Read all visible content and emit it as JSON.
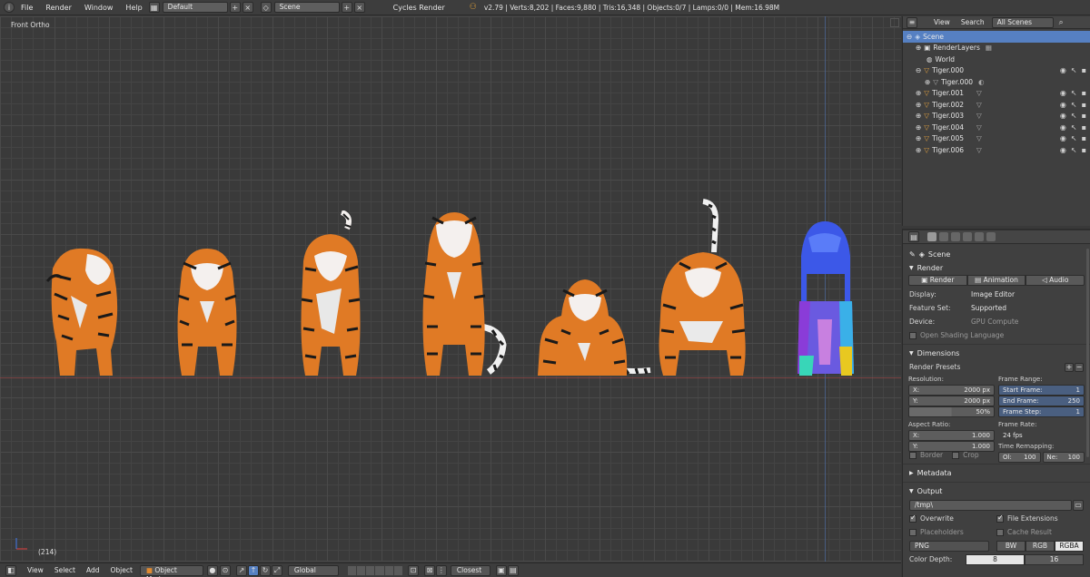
{
  "topbar": {
    "menus": [
      "File",
      "Render",
      "Window",
      "Help"
    ],
    "layout": "Default",
    "scene": "Scene",
    "engine": "Cycles Render",
    "stats": "v2.79 | Verts:8,202 | Faces:9,880 | Tris:16,348 | Objects:0/7 | Lamps:0/0 | Mem:16.98M"
  },
  "viewport": {
    "view_label": "Front Ortho",
    "frame_label": "(214)"
  },
  "bottombar": {
    "menus": [
      "View",
      "Select",
      "Add",
      "Object"
    ],
    "mode": "Object Mode",
    "pivot": "Global",
    "snap": "Closest"
  },
  "outliner": {
    "menus": [
      "View",
      "Search"
    ],
    "filter": "All Scenes",
    "items": [
      {
        "label": "Scene",
        "indent": 0
      },
      {
        "label": "RenderLayers",
        "indent": 1
      },
      {
        "label": "World",
        "indent": 1
      },
      {
        "label": "Tiger.000",
        "indent": 1
      },
      {
        "label": "Tiger.000",
        "indent": 2
      },
      {
        "label": "Tiger.001",
        "indent": 1
      },
      {
        "label": "Tiger.002",
        "indent": 1
      },
      {
        "label": "Tiger.003",
        "indent": 1
      },
      {
        "label": "Tiger.004",
        "indent": 1
      },
      {
        "label": "Tiger.005",
        "indent": 1
      },
      {
        "label": "Tiger.006",
        "indent": 1
      }
    ]
  },
  "properties": {
    "context": "Scene",
    "render": {
      "title": "Render",
      "buttons": [
        "Render",
        "Animation",
        "Audio"
      ],
      "display_label": "Display:",
      "display_value": "Image Editor",
      "feature_label": "Feature Set:",
      "feature_value": "Supported",
      "device_label": "Device:",
      "device_value": "GPU Compute",
      "osl_label": "Open Shading Language"
    },
    "dimensions": {
      "title": "Dimensions",
      "presets": "Render Presets",
      "resolution_label": "Resolution:",
      "res_x_label": "X:",
      "res_x": "2000 px",
      "res_y_label": "Y:",
      "res_y": "2000 px",
      "res_pct": "50%",
      "frame_range_label": "Frame Range:",
      "start_label": "Start Frame:",
      "start": "1",
      "end_label": "End Frame:",
      "end": "250",
      "step_label": "Frame Step:",
      "step": "1",
      "aspect_label": "Aspect Ratio:",
      "asp_x_label": "X:",
      "asp_x": "1.000",
      "asp_y_label": "Y:",
      "asp_y": "1.000",
      "framerate_label": "Frame Rate:",
      "framerate": "24 fps",
      "remap_label": "Time Remapping:",
      "old_label": "Ol:",
      "old": "100",
      "new_label": "Ne:",
      "new": "100",
      "border_label": "Border",
      "crop_label": "Crop"
    },
    "metadata_title": "Metadata",
    "output": {
      "title": "Output",
      "path": "/tmp\\",
      "overwrite": "Overwrite",
      "file_ext": "File Extensions",
      "placeholders": "Placeholders",
      "cache": "Cache Result",
      "format": "PNG",
      "color_modes": [
        "BW",
        "RGB",
        "RGBA"
      ],
      "color_depth_label": "Color Depth:",
      "depth_8": "8",
      "depth_16": "16"
    }
  }
}
